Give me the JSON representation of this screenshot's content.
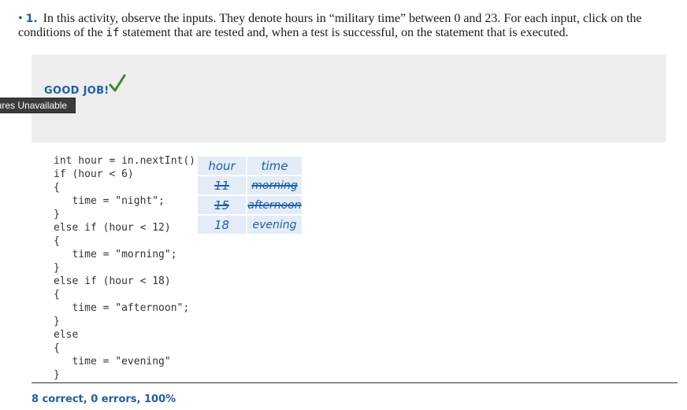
{
  "question": {
    "bullet": "•",
    "number": "1.",
    "text_before_code": "In this activity, observe the inputs. They denote hours in “military time” between 0 and 23. For each input, click on the conditions of the",
    "code_word": "if",
    "text_after_code": "statement that are tested and, when a test is successful, on the statement that is executed."
  },
  "feedback": {
    "message": "GOOD JOB!",
    "unavailable_label": "gures Unavailable"
  },
  "code_lines": [
    "int hour = in.nextInt();",
    "if (hour < 6)",
    "{",
    "   time = \"night\";",
    "}",
    "else if (hour < 12)",
    "{",
    "   time = \"morning\";",
    "}",
    "else if (hour < 18)",
    "{",
    "   time = \"afternoon\";",
    "}",
    "else",
    "{",
    "   time = \"evening\"",
    "}"
  ],
  "trace_table": {
    "headers": [
      "hour",
      "time"
    ],
    "rows": [
      {
        "hour": "11",
        "time": "morning",
        "struck": true
      },
      {
        "hour": "15",
        "time": "afternoon",
        "struck": true
      },
      {
        "hour": "18",
        "time": "evening",
        "struck": false
      }
    ]
  },
  "score": "8 correct, 0 errors, 100%",
  "colors": {
    "accent": "#1f5fa8",
    "success": "#3a8a2e",
    "panel": "#eeeeee",
    "table_cell": "#e4ecf7"
  }
}
